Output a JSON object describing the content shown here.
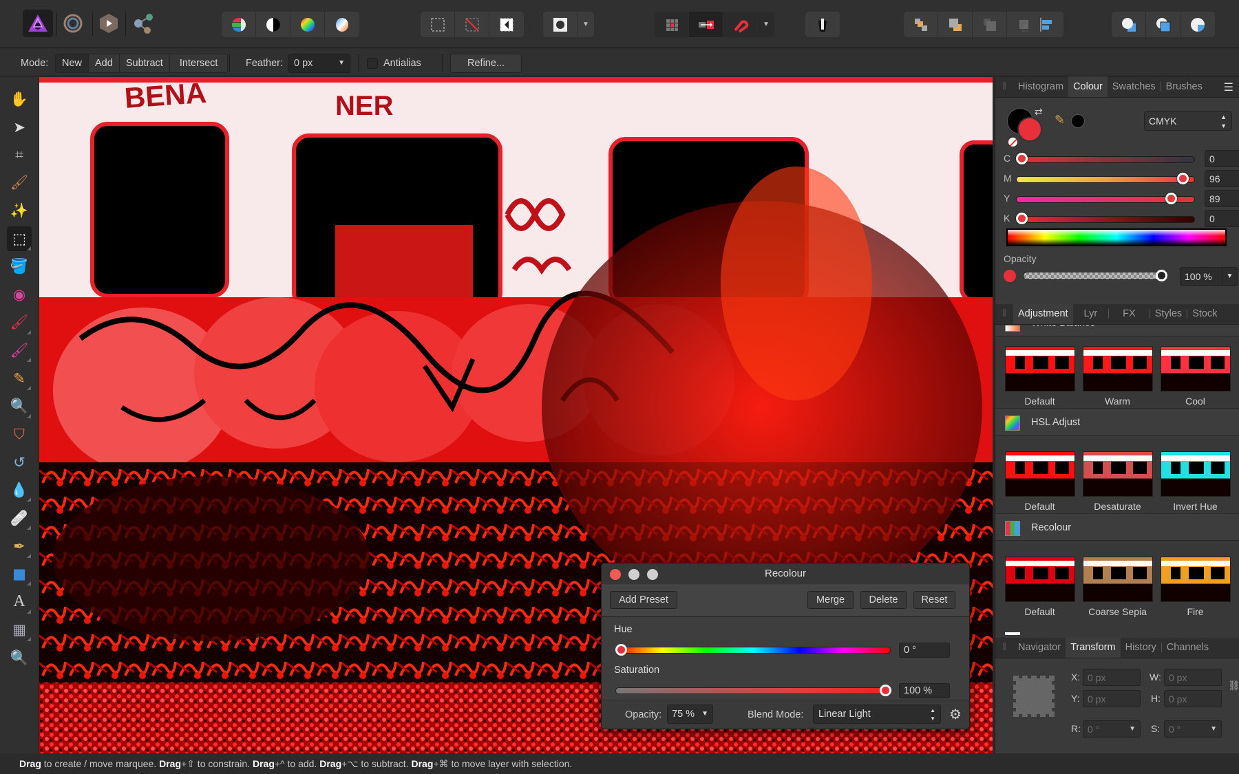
{
  "app": {
    "name": "Affinity Photo"
  },
  "toolbar": {
    "personas": [
      {
        "name": "photo-persona",
        "active": true
      },
      {
        "name": "liquify-persona",
        "active": false
      },
      {
        "name": "develop-persona",
        "active": false
      },
      {
        "name": "export-persona",
        "active": false
      }
    ],
    "adjust_buttons": [
      "levels",
      "black-white",
      "hsl-wheel",
      "white-balance"
    ],
    "selection_buttons": [
      "marquee-selection",
      "deselect",
      "invert-selection"
    ],
    "quickmask_button": "quick-mask",
    "snapping_buttons": [
      "snapping-grid",
      "move-to-back",
      "snapping-magnet"
    ],
    "assistant_button": "assistant",
    "arrange_buttons": [
      "move-forward",
      "move-back",
      "bring-to-front",
      "send-to-back"
    ],
    "align_button": "align-left",
    "boolean_buttons": [
      "add-shape",
      "subtract-shape",
      "intersect-shape"
    ]
  },
  "context": {
    "mode_label": "Mode:",
    "modes": [
      "New",
      "Add",
      "Subtract",
      "Intersect"
    ],
    "active_mode": "New",
    "feather_label": "Feather:",
    "feather_value": "0 px",
    "antialias_label": "Antialias",
    "antialias_checked": false,
    "refine_label": "Refine..."
  },
  "tools": [
    {
      "name": "hand-tool",
      "glyph": "✋",
      "active": false,
      "flyout": false
    },
    {
      "name": "move-tool",
      "glyph": "➤",
      "active": false,
      "flyout": false
    },
    {
      "name": "crop-tool",
      "glyph": "⌗",
      "active": false,
      "flyout": false
    },
    {
      "name": "selection-brush-tool",
      "glyph": "🖌",
      "active": false,
      "flyout": false
    },
    {
      "name": "magic-wand-tool",
      "glyph": "✨",
      "active": false,
      "flyout": false
    },
    {
      "name": "rectangular-marquee-tool",
      "glyph": "⬚",
      "active": true,
      "flyout": true
    },
    {
      "name": "flood-fill-tool",
      "glyph": "🪣",
      "active": false,
      "flyout": false
    },
    {
      "name": "colour-picker-tool",
      "glyph": "◉",
      "active": false,
      "flyout": false
    },
    {
      "name": "paint-brush-tool",
      "glyph": "🖌",
      "active": false,
      "flyout": true
    },
    {
      "name": "colour-replacement-tool",
      "glyph": "🖌",
      "active": false,
      "flyout": true
    },
    {
      "name": "erase-tool",
      "glyph": "✎",
      "active": false,
      "flyout": true
    },
    {
      "name": "dodge-tool",
      "glyph": "🔍",
      "active": false,
      "flyout": true
    },
    {
      "name": "clone-tool",
      "glyph": "⛉",
      "active": false,
      "flyout": false
    },
    {
      "name": "undo-brush-tool",
      "glyph": "↺",
      "active": false,
      "flyout": false
    },
    {
      "name": "blur-tool",
      "glyph": "💧",
      "active": false,
      "flyout": true
    },
    {
      "name": "healing-tool",
      "glyph": "🩹",
      "active": false,
      "flyout": true
    },
    {
      "name": "pen-tool",
      "glyph": "✒",
      "active": false,
      "flyout": true
    },
    {
      "name": "rectangle-tool",
      "glyph": "■",
      "active": false,
      "flyout": true
    },
    {
      "name": "text-tool",
      "glyph": "A",
      "active": false,
      "flyout": true
    },
    {
      "name": "mesh-warp-tool",
      "glyph": "▦",
      "active": false,
      "flyout": true
    },
    {
      "name": "zoom-tool",
      "glyph": "🔍",
      "active": false,
      "flyout": false
    }
  ],
  "colour_panel": {
    "tabs": [
      "Histogram",
      "Colour",
      "Swatches",
      "Brushes"
    ],
    "active_tab": "Colour",
    "primary_colour": "#e8303a",
    "secondary_colour": "#000000",
    "model": "CMYK",
    "sliders": [
      {
        "label": "C",
        "value": "0",
        "fraction": 0.0
      },
      {
        "label": "M",
        "value": "96",
        "fraction": 0.96
      },
      {
        "label": "Y",
        "value": "89",
        "fraction": 0.89
      },
      {
        "label": "K",
        "value": "0",
        "fraction": 0.0
      }
    ],
    "opacity_label": "Opacity",
    "opacity_value": "100 %",
    "opacity_fraction": 1.0
  },
  "adjustment_panel": {
    "tabs": [
      "Adjustment",
      "Lyr",
      "FX",
      "Styles",
      "Stock"
    ],
    "active_tab": "Adjustment",
    "sections": [
      {
        "title": "White Balance",
        "presets": [
          "Default",
          "Warm",
          "Cool"
        ]
      },
      {
        "title": "HSL Adjust",
        "presets": [
          "Default",
          "Desaturate",
          "Invert Hue"
        ]
      },
      {
        "title": "Recolour",
        "presets": [
          "Default",
          "Coarse Sepia",
          "Fire"
        ]
      }
    ]
  },
  "transform_panel": {
    "tabs": [
      "Navigator",
      "Transform",
      "History",
      "Channels"
    ],
    "active_tab": "Transform",
    "x_label": "X:",
    "x_value": "0 px",
    "y_label": "Y:",
    "y_value": "0 px",
    "w_label": "W:",
    "w_value": "0 px",
    "h_label": "H:",
    "h_value": "0 px",
    "r_label": "R:",
    "r_value": "0 °",
    "s_label": "S:",
    "s_value": "0 °"
  },
  "dialog": {
    "title": "Recolour",
    "add_preset": "Add Preset",
    "merge": "Merge",
    "delete": "Delete",
    "reset": "Reset",
    "hue_label": "Hue",
    "hue_value": "0 °",
    "hue_fraction": 0.0,
    "saturation_label": "Saturation",
    "saturation_value": "100 %",
    "saturation_fraction": 1.0,
    "opacity_label": "Opacity:",
    "opacity_value": "75 %",
    "blend_label": "Blend Mode:",
    "blend_value": "Linear Light"
  },
  "status": {
    "parts": [
      {
        "b": "Drag",
        "t": " to create / move marquee. "
      },
      {
        "b": "Drag",
        "t": "+⇧ to constrain. "
      },
      {
        "b": "Drag",
        "t": "+^ to add. "
      },
      {
        "b": "Drag",
        "t": "+⌥ to subtract. "
      },
      {
        "b": "Drag",
        "t": "+⌘ to move layer with selection."
      }
    ]
  }
}
